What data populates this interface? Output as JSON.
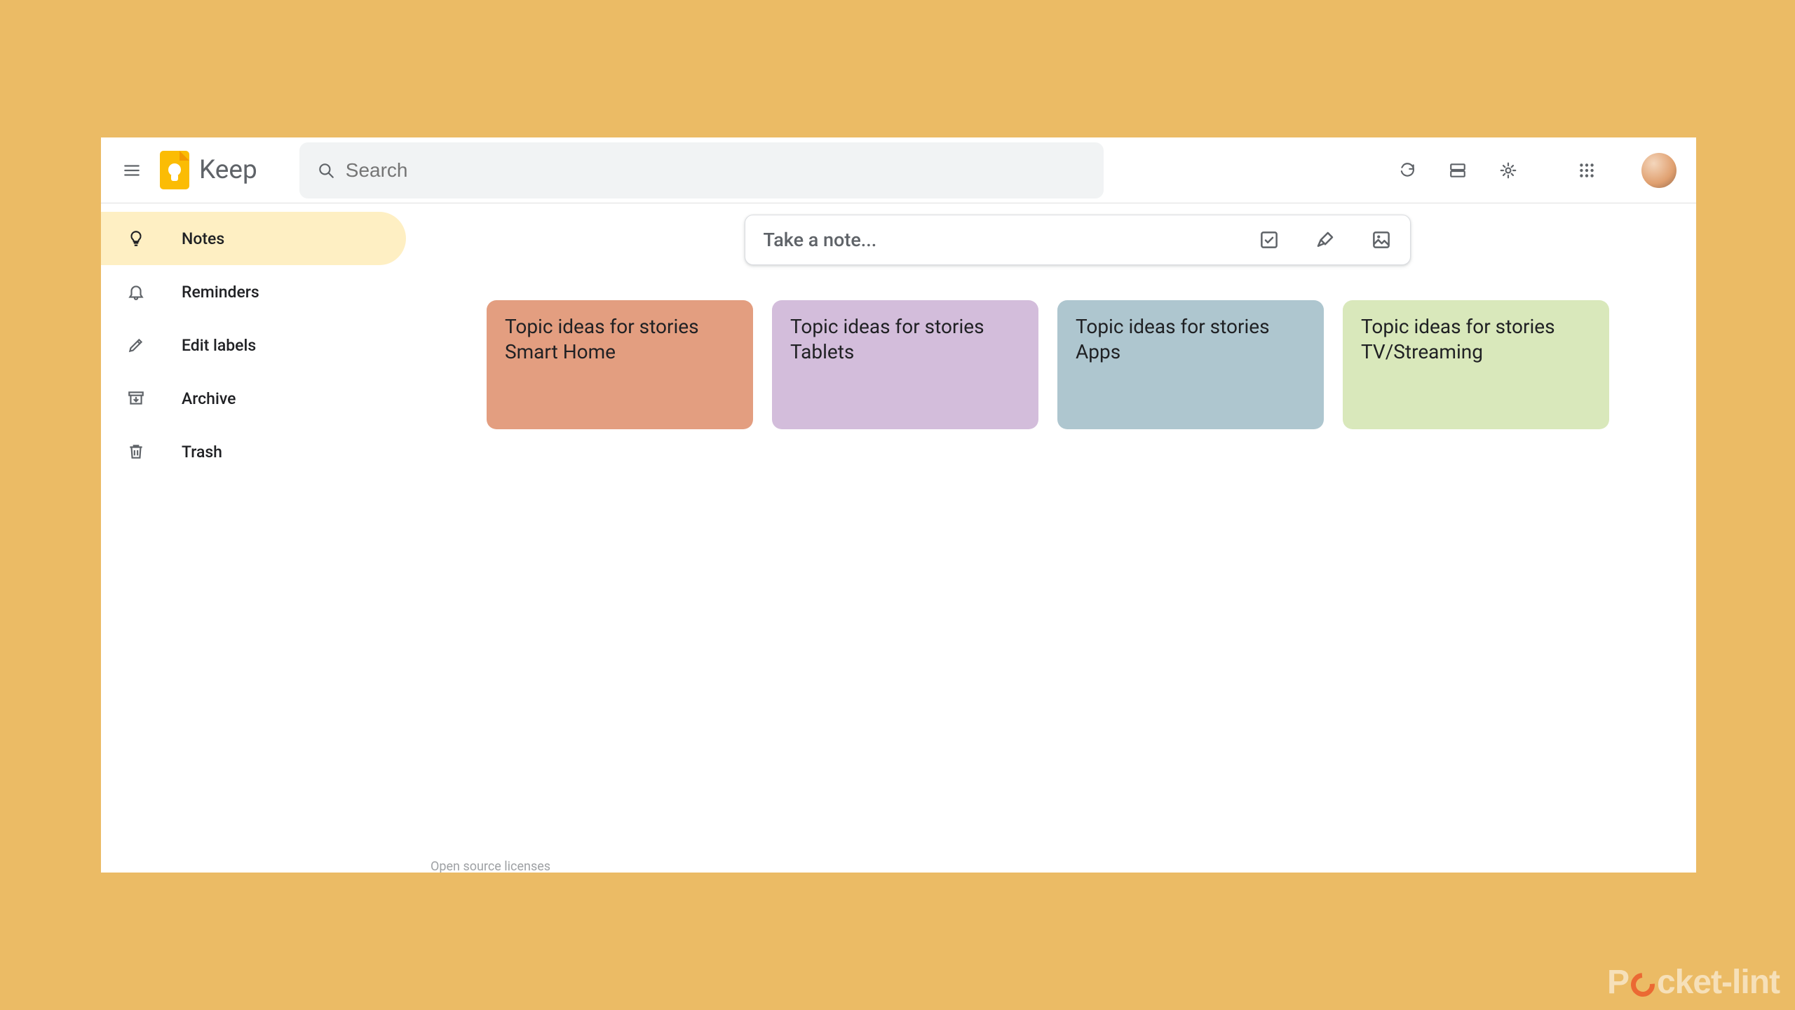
{
  "header": {
    "app_name": "Keep",
    "search_placeholder": "Search"
  },
  "sidebar": {
    "items": [
      {
        "label": "Notes"
      },
      {
        "label": "Reminders"
      },
      {
        "label": "Edit labels"
      },
      {
        "label": "Archive"
      },
      {
        "label": "Trash"
      }
    ]
  },
  "take_note": {
    "placeholder": "Take a note..."
  },
  "notes": [
    {
      "title_line1": "Topic ideas for stories",
      "title_line2": "Smart Home",
      "color": "coral"
    },
    {
      "title_line1": "Topic ideas for stories",
      "title_line2": "Tablets",
      "color": "purple"
    },
    {
      "title_line1": "Topic ideas for stories",
      "title_line2": "Apps",
      "color": "blue"
    },
    {
      "title_line1": "Topic ideas for stories",
      "title_line2": "TV/Streaming",
      "color": "green"
    }
  ],
  "footer": {
    "link": "Open source licenses"
  },
  "watermark": {
    "prefix": "P",
    "suffix": "cket-lint"
  }
}
